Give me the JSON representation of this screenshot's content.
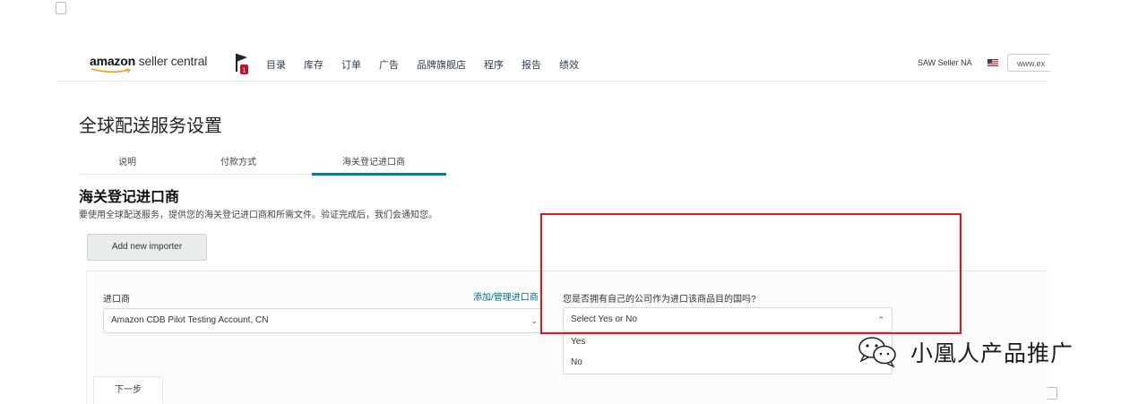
{
  "header": {
    "logo_brand": "amazon",
    "logo_suffix": "seller central",
    "nav": [
      "目录",
      "库存",
      "订单",
      "广告",
      "品牌旗舰店",
      "程序",
      "报告",
      "绩效"
    ],
    "account": "SAW Seller NA",
    "language": "www.ex"
  },
  "page": {
    "title": "全球配送服务设置",
    "tabs": [
      "说明",
      "付款方式",
      "海关登记进口商"
    ],
    "active_tab": "海关登记进口商"
  },
  "section": {
    "title": "海关登记进口商",
    "description": "要使用全球配送服务，提供您的海关登记进口商和所需文件。验证完成后，我们会通知您。",
    "add_button": "Add new importer"
  },
  "form": {
    "importer_label": "进口商",
    "manage_link": "添加/管理进口商",
    "importer_value": "Amazon CDB Pilot Testing Account, CN",
    "question_label": "您是否拥有自己的公司作为进口该商品目的国吗?",
    "yn_placeholder": "Select Yes or No",
    "options": [
      "Yes",
      "No"
    ],
    "next_button": "下一步"
  },
  "watermark": {
    "text": "小凰人产品推广"
  },
  "colors": {
    "highlight_box": "#e8141b",
    "tab_active": "#008296",
    "link": "#007185"
  }
}
